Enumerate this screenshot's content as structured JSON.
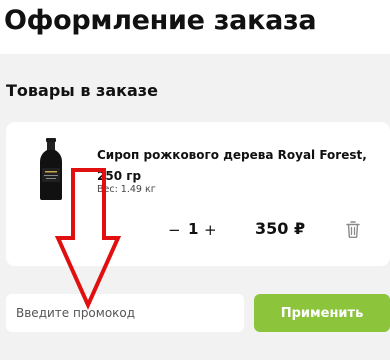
{
  "header": {
    "title": "Оформление заказа"
  },
  "order": {
    "section_title": "Товары в заказе",
    "items": [
      {
        "name": "Сироп рожкового дерева Royal Forest, 250 гр",
        "weight": "Вес: 1.49 кг",
        "quantity": "1",
        "price": "350 ₽",
        "decrease_label": "−",
        "increase_label": "+"
      }
    ]
  },
  "promo": {
    "placeholder": "Введите промокод",
    "value": "",
    "apply_label": "Применить"
  },
  "colors": {
    "accent": "#8cc43c",
    "annotation": "#e01010",
    "panel": "#f2f2f2"
  },
  "icons": [
    "trash-icon",
    "annotation-arrow-icon"
  ]
}
